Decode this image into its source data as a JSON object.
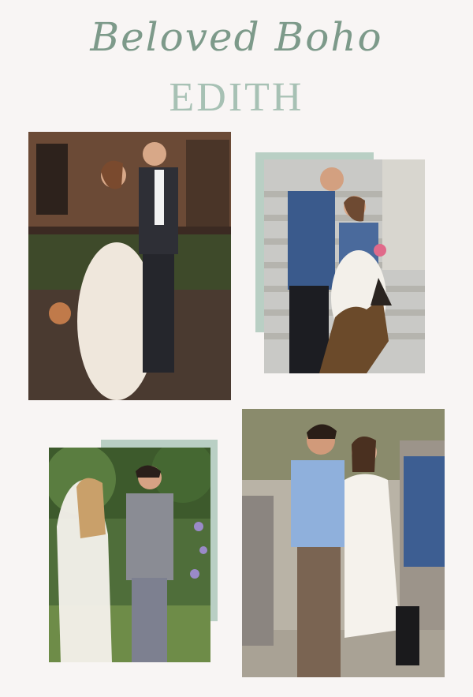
{
  "header": {
    "script_title": "Beloved Boho",
    "main_title": "EDITH"
  },
  "colors": {
    "background": "#f8f5f4",
    "accent_green": "#7d9a8a",
    "frame_green": "#b9cfc4"
  }
}
